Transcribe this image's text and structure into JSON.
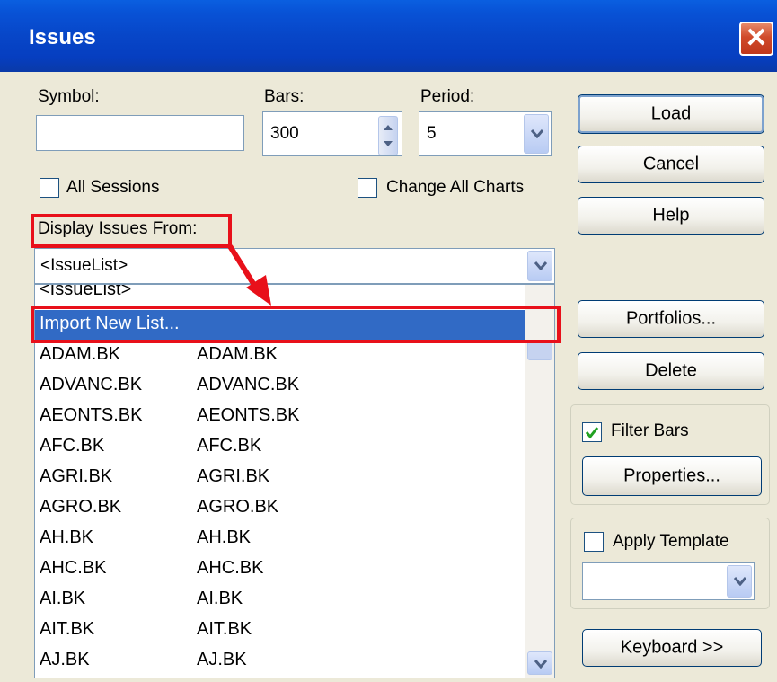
{
  "window": {
    "title": "Issues"
  },
  "symbol": {
    "label": "Symbol:",
    "value": ""
  },
  "bars": {
    "label": "Bars:",
    "value": "300"
  },
  "period": {
    "label": "Period:",
    "value": "5"
  },
  "all_sessions": {
    "label": "All Sessions",
    "checked": false
  },
  "change_all_charts": {
    "label": "Change All Charts",
    "checked": false
  },
  "display_from": {
    "label": "Display Issues From:",
    "value": "<IssueList>"
  },
  "list": {
    "partial_top": "<IssueList>",
    "highlighted": "Import New List...",
    "rows": [
      {
        "symbol": "ADAM.BK",
        "name": "ADAM.BK"
      },
      {
        "symbol": "ADVANC.BK",
        "name": "ADVANC.BK"
      },
      {
        "symbol": "AEONTS.BK",
        "name": "AEONTS.BK"
      },
      {
        "symbol": "AFC.BK",
        "name": "AFC.BK"
      },
      {
        "symbol": "AGRI.BK",
        "name": "AGRI.BK"
      },
      {
        "symbol": "AGRO.BK",
        "name": "AGRO.BK"
      },
      {
        "symbol": "AH.BK",
        "name": "AH.BK"
      },
      {
        "symbol": "AHC.BK",
        "name": "AHC.BK"
      },
      {
        "symbol": "AI.BK",
        "name": "AI.BK"
      },
      {
        "symbol": "AIT.BK",
        "name": "AIT.BK"
      },
      {
        "symbol": "AJ.BK",
        "name": "AJ.BK"
      }
    ]
  },
  "buttons": {
    "load": "Load",
    "cancel": "Cancel",
    "help": "Help",
    "portfolios": "Portfolios...",
    "delete": "Delete",
    "properties": "Properties...",
    "keyboard": "Keyboard >>"
  },
  "filter_bars": {
    "label": "Filter Bars",
    "checked": true
  },
  "apply_template": {
    "label": "Apply Template",
    "checked": false,
    "value": ""
  },
  "colors": {
    "titlebar": "#0746c8",
    "highlight": "#316ac5",
    "annotation": "#e8101a",
    "dialog": "#ece9d8"
  },
  "icons": {
    "close": "close-icon",
    "checkmark": "checkmark-icon",
    "arrow": "arrow-annotation"
  }
}
